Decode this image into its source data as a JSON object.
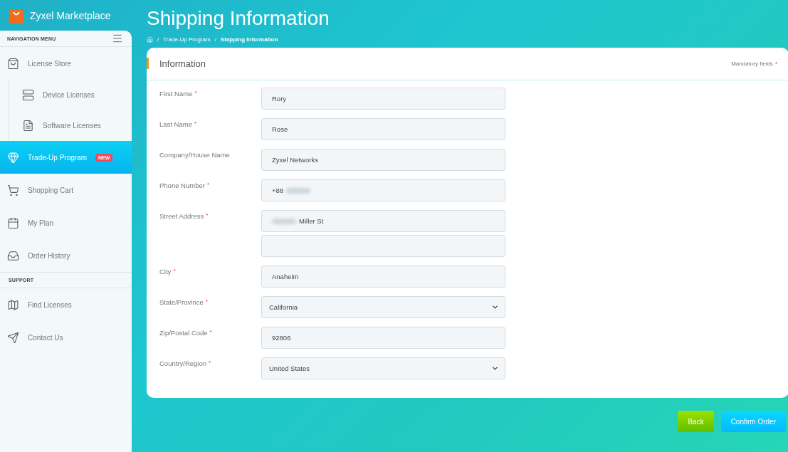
{
  "brand": {
    "name": "Zyxel Marketplace"
  },
  "page_title": "Shipping Information",
  "breadcrumb": [
    {
      "separator": "/",
      "label": "Trade-Up Program",
      "current": false
    },
    {
      "separator": "/",
      "label": "Shipping Information",
      "current": true
    }
  ],
  "sidebar": {
    "header": "NAVIGATION MENU",
    "sections": [
      {
        "items": [
          {
            "label": "License Store",
            "kind": "main",
            "selected": false
          },
          {
            "label": "Device Licenses",
            "kind": "sub",
            "selected": false
          },
          {
            "label": "Software Licenses",
            "kind": "sub",
            "selected": false
          },
          {
            "label": "Trade-Up Program",
            "kind": "main",
            "selected": true,
            "badge": "NEW"
          },
          {
            "label": "Shopping Cart",
            "kind": "main",
            "selected": false
          },
          {
            "label": "My Plan",
            "kind": "main",
            "selected": false
          },
          {
            "label": "Order History",
            "kind": "main",
            "selected": false
          }
        ]
      },
      {
        "heading": "SUPPORT",
        "items": [
          {
            "label": "Find Licenses",
            "kind": "main",
            "selected": false
          },
          {
            "label": "Contact Us",
            "kind": "main",
            "selected": false
          }
        ]
      }
    ]
  },
  "form": {
    "title": "Information",
    "note": "Mandatory fields",
    "note_mark": "*",
    "fields": [
      {
        "label": "First Name",
        "required_mark": "*",
        "kind": "text",
        "value": "Rory"
      },
      {
        "label": "Last Name",
        "required_mark": "*",
        "kind": "text",
        "value": "Rose"
      },
      {
        "label": "Company/House Name",
        "kind": "text",
        "value": "Zyxel Networks"
      },
      {
        "label": "Phone Number",
        "required_mark": "*",
        "kind": "text",
        "value": "+88",
        "blurred_suffix": true
      },
      {
        "label": "Street Address",
        "required_mark": "*",
        "kind": "text",
        "value": "Miller St",
        "blurred_prefix": true,
        "second_line": true
      },
      {
        "label": "City",
        "required_mark": "*",
        "kind": "text",
        "value": "Anaheim"
      },
      {
        "label": "State/Province",
        "required_mark": "*",
        "kind": "select",
        "value": "California"
      },
      {
        "label": "Zip/Postal Code",
        "required_mark": "*",
        "kind": "text",
        "value": "92806"
      },
      {
        "label": "Country/Region",
        "required_mark": "*",
        "kind": "select",
        "value": "United States"
      }
    ]
  },
  "buttons": [
    {
      "label": "Back",
      "kind": "secondary"
    },
    {
      "label": "Confirm Order",
      "kind": "primary"
    }
  ]
}
